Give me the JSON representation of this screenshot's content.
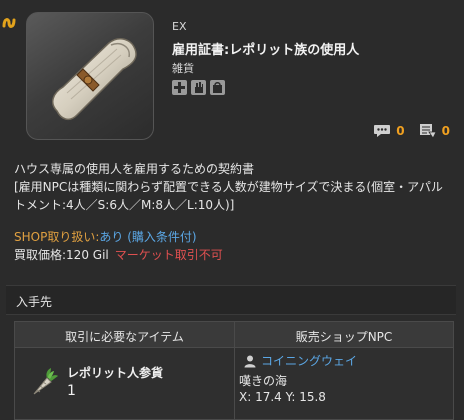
{
  "item": {
    "type_label": "EX",
    "name": "雇用証書:レポリット族の使用人",
    "category": "雑貨",
    "flag_icons": [
      "cross-icon",
      "hand-icon",
      "bag-icon"
    ]
  },
  "counters": {
    "comments": "0",
    "reports": "0"
  },
  "description": {
    "line1": "ハウス専属の使用人を雇用するための契約書",
    "line2": "[雇用NPCは種類に関わらず配置できる人数が建物サイズで決まる(個室・アパル",
    "line3": "トメント:4人／S:6人／M:8人／L:10人)]"
  },
  "shop": {
    "label": "SHOP取り扱い:",
    "value": "あり",
    "link": "(購入条件付)"
  },
  "price": {
    "label": "買取価格:",
    "value": "120 Gil",
    "market_note": "マーケット取引不可"
  },
  "acquire": {
    "title": "入手先"
  },
  "exchange": {
    "col_item": "取引に必要なアイテム",
    "col_npc": "販売ショップNPC",
    "currency_name": "レポリット人参貨",
    "currency_qty": "1",
    "npc_name": "コイニングウェイ",
    "npc_area": "嘆きの海",
    "npc_coords": "X: 17.4 Y: 15.8"
  },
  "colors": {
    "accent_orange": "#f0a020",
    "link_blue": "#5ba7e5",
    "warning_red": "#e05050"
  }
}
